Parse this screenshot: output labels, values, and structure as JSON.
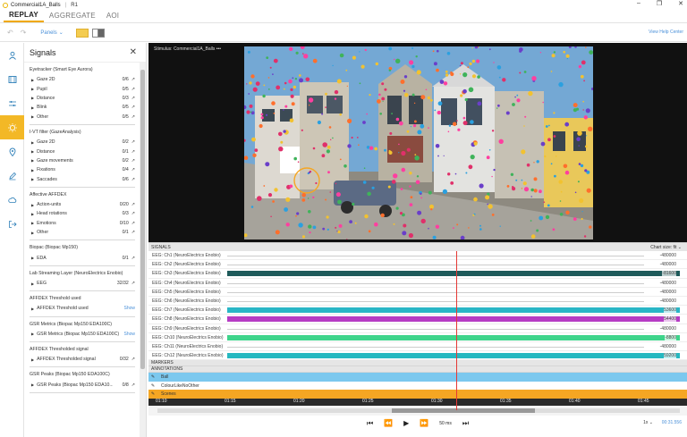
{
  "titlebar": {
    "doc_title": "Commercial1A_Balls",
    "respondent": "R1",
    "minimize": "–",
    "restore": "❐",
    "close": "✕"
  },
  "nav": {
    "tabs": [
      "REPLAY",
      "AGGREGATE",
      "AOI"
    ],
    "active": "REPLAY"
  },
  "toolbar": {
    "panels_label": "Panels",
    "help_link": "View Help Center"
  },
  "rail": {
    "items": [
      "user-icon",
      "film-icon",
      "sliders-icon",
      "signals-icon",
      "location-icon",
      "edit-icon",
      "cloud-icon",
      "export-icon"
    ],
    "active": "signals-icon"
  },
  "panel": {
    "title": "Signals",
    "groups": [
      {
        "title": "Eyetracker (Smart Eye Aurora)",
        "rows": [
          {
            "label": "Gaze 2D",
            "count": "0/6"
          },
          {
            "label": "Pupil",
            "count": "0/5"
          },
          {
            "label": "Distance",
            "count": "0/3"
          },
          {
            "label": "Blink",
            "count": "0/5"
          },
          {
            "label": "Other",
            "count": "0/5"
          }
        ]
      },
      {
        "title": "I-VT filter (GazeAnalysis)",
        "rows": [
          {
            "label": "Gaze 2D",
            "count": "0/2"
          },
          {
            "label": "Distance",
            "count": "0/1"
          },
          {
            "label": "Gaze movements",
            "count": "0/2"
          },
          {
            "label": "Fixations",
            "count": "0/4"
          },
          {
            "label": "Saccades",
            "count": "0/6"
          }
        ]
      },
      {
        "title": "Affective AFFDEX",
        "rows": [
          {
            "label": "Action-units",
            "count": "0/20"
          },
          {
            "label": "Head rotations",
            "count": "0/3"
          },
          {
            "label": "Emotions",
            "count": "0/10"
          },
          {
            "label": "Other",
            "count": "0/1"
          }
        ]
      },
      {
        "title": "Biopac (Biopac Mp150)",
        "rows": [
          {
            "label": "EDA",
            "count": "0/1"
          }
        ]
      },
      {
        "title": "Lab Streaming Layer (NeuroElectrics Enobio)",
        "rows": [
          {
            "label": "EEG",
            "count": "32/32"
          }
        ]
      },
      {
        "title": "AFFDEX Threshold used",
        "rows": [
          {
            "label": "AFFDEX Threshold used",
            "count": "",
            "show": "Show"
          }
        ]
      },
      {
        "title": "GSR Metrics (Biopac Mp150 EDA100C)",
        "rows": [
          {
            "label": "GSR Metrics (Biopac Mp150 EDA100C)",
            "count": "",
            "show": "Show"
          }
        ]
      },
      {
        "title": "AFFDEX Thresholded signal",
        "rows": [
          {
            "label": "AFFDEX Thresholded signal",
            "count": "0/32"
          }
        ]
      },
      {
        "title": "GSR Peaks (Biopac Mp150 EDA100C)",
        "rows": [
          {
            "label": "GSR Peaks (Biopac Mp150 EDA10...",
            "count": "0/8"
          }
        ]
      }
    ]
  },
  "stimulus": {
    "label": "Stimulus: Commercial1A_Balls",
    "menu": "•••"
  },
  "signals": {
    "header": "SIGNALS",
    "chart_size_label": "Chart size:",
    "chart_size_value": "fit",
    "tracks": [
      {
        "name": "EEG: Ch1 (NeuroElectrics Enobio)",
        "value": "-480000",
        "color": "",
        "kind": "thin"
      },
      {
        "name": "EEG: Ch2 (NeuroElectrics Enobio)",
        "value": "-480000",
        "color": "",
        "kind": "thin"
      },
      {
        "name": "EEG: Ch3 (NeuroElectrics Enobio)",
        "value": "-81600",
        "color": "#1e5a5a",
        "kind": "band"
      },
      {
        "name": "EEG: Ch4 (NeuroElectrics Enobio)",
        "value": "-480000",
        "color": "",
        "kind": "thin"
      },
      {
        "name": "EEG: Ch5 (NeuroElectrics Enobio)",
        "value": "-480000",
        "color": "",
        "kind": "thin"
      },
      {
        "name": "EEG: Ch6 (NeuroElectrics Enobio)",
        "value": "-480000",
        "color": "",
        "kind": "thin"
      },
      {
        "name": "EEG: Ch7 (NeuroElectrics Enobio)",
        "value": "53600",
        "color": "#29b6c6",
        "kind": "band"
      },
      {
        "name": "EEG: Ch8 (NeuroElectrics Enobio)",
        "value": "54400",
        "color": "#b63cc4",
        "kind": "band"
      },
      {
        "name": "EEG: Ch9 (NeuroElectrics Enobio)",
        "value": "-480000",
        "color": "",
        "kind": "thin"
      },
      {
        "name": "EEG: Ch10 (NeuroElectrics Enobio)",
        "value": "-8800",
        "color": "#3dd48a",
        "kind": "band"
      },
      {
        "name": "EEG: Ch11 (NeuroElectrics Enobio)",
        "value": "-480000",
        "color": "",
        "kind": "thin"
      },
      {
        "name": "EEG: Ch12 (NeuroElectrics Enobio)",
        "value": "59200",
        "color": "#26b8c0",
        "kind": "band"
      }
    ],
    "markers_label": "MARKERS",
    "annotations_label": "ANNOTATIONS",
    "annotation_rows": [
      {
        "label": "Ball",
        "color": "#7cc8ee"
      },
      {
        "label": "ColourLikeNoOther",
        "color": "#ffffff"
      },
      {
        "label": "Scenes",
        "color": "#f5a623"
      }
    ],
    "timeline_ticks": [
      "01:10",
      "01:15",
      "01:20",
      "01:25",
      "01:30",
      "01:35",
      "01:40",
      "01:45"
    ],
    "playback": {
      "speed": "1x",
      "time": "00:31.556",
      "step_label": "50 ms"
    }
  }
}
